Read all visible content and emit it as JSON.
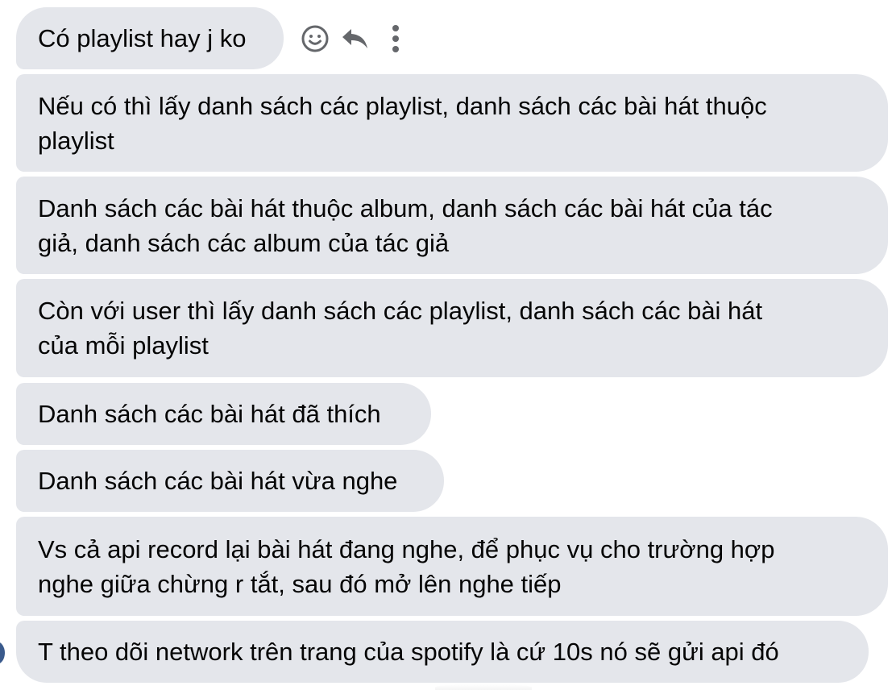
{
  "messages": [
    {
      "lines": [
        "Có playlist hay j ko"
      ]
    },
    {
      "lines": [
        "Nếu có thì lấy danh sách các playlist, danh sách các bài hát thuộc",
        "playlist"
      ]
    },
    {
      "lines": [
        "Danh sách các bài hát thuộc album, danh sách các bài hát của tác",
        "giả, danh sách các album của tác giả"
      ]
    },
    {
      "lines": [
        "Còn với user thì lấy danh sách các playlist, danh sách các bài hát",
        "của mỗi playlist"
      ]
    },
    {
      "lines": [
        "Danh sách các bài hát đã thích"
      ]
    },
    {
      "lines": [
        "Danh sách các bài hát vừa nghe"
      ]
    },
    {
      "lines": [
        "Vs cả api record lại bài hát đang nghe, để phục vụ cho trường hợp",
        "nghe giữa chừng r tắt, sau đó mở lên nghe tiếp"
      ]
    },
    {
      "lines": [
        "T theo dõi network trên trang của spotify là cứ 10s nó sẽ gửi api đó"
      ]
    }
  ],
  "message_actions": {
    "icons": [
      "smiley-icon",
      "reply-icon",
      "more-icon"
    ]
  },
  "colors": {
    "bubble_bg": "#e4e6eb",
    "text": "#050505",
    "icon": "#65676b"
  }
}
